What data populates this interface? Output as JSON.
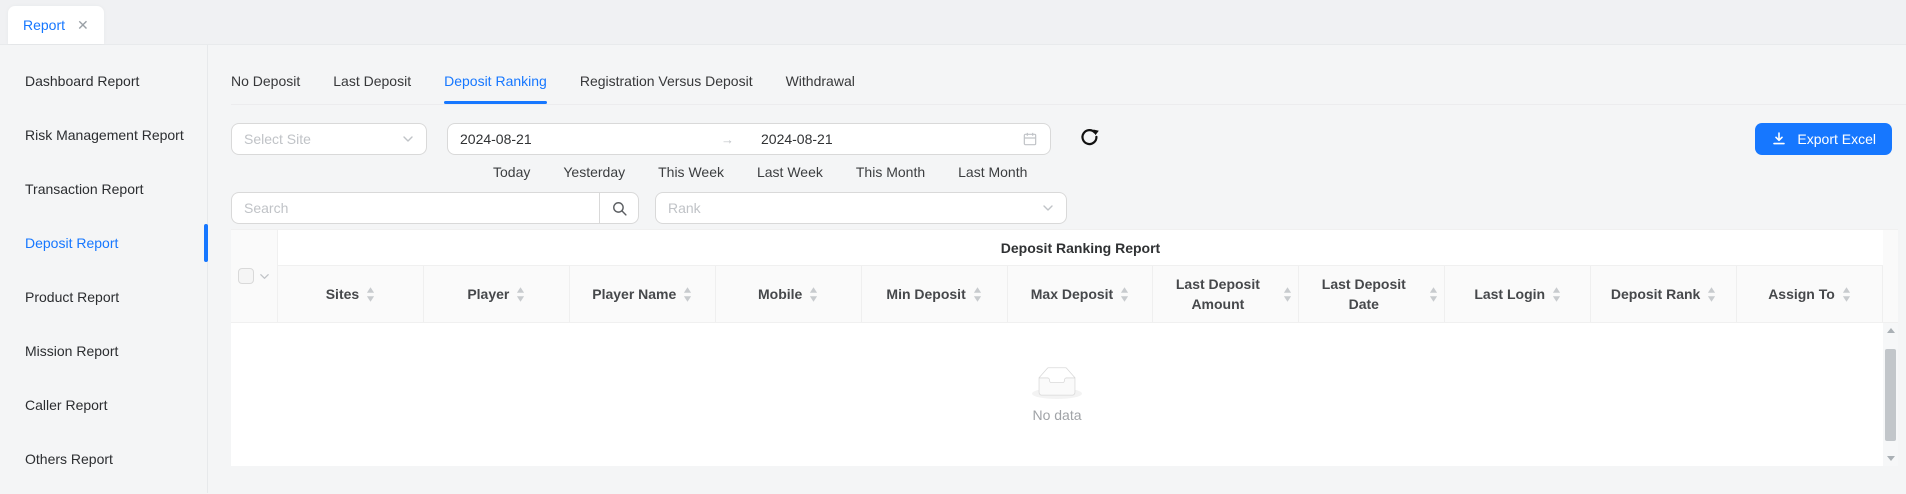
{
  "window": {
    "tab_title": "Report",
    "close_glyph": "✕"
  },
  "sidebar": {
    "items": [
      {
        "label": "Dashboard Report",
        "active": false
      },
      {
        "label": "Risk Management Report",
        "active": false
      },
      {
        "label": "Transaction Report",
        "active": false
      },
      {
        "label": "Deposit Report",
        "active": true
      },
      {
        "label": "Product Report",
        "active": false
      },
      {
        "label": "Mission Report",
        "active": false
      },
      {
        "label": "Caller Report",
        "active": false
      },
      {
        "label": "Others Report",
        "active": false
      }
    ]
  },
  "tabs": {
    "items": [
      "No Deposit",
      "Last Deposit",
      "Deposit Ranking",
      "Registration Versus Deposit",
      "Withdrawal"
    ],
    "active": "Deposit Ranking"
  },
  "filters": {
    "site_placeholder": "Select Site",
    "date_range": {
      "start": "2024-08-21",
      "separator": "→",
      "end": "2024-08-21"
    },
    "quick_links": [
      "Today",
      "Yesterday",
      "This Week",
      "Last Week",
      "This Month",
      "Last Month"
    ],
    "search_placeholder": "Search",
    "rank_placeholder": "Rank",
    "export_label": "Export Excel"
  },
  "table": {
    "title": "Deposit Ranking Report",
    "columns": [
      "Sites",
      "Player",
      "Player Name",
      "Mobile",
      "Min Deposit",
      "Max Deposit",
      "Last Deposit Amount",
      "Last Deposit Date",
      "Last Login",
      "Deposit Rank",
      "Assign To"
    ],
    "rows": [],
    "empty_text": "No data"
  },
  "colors": {
    "accent": "#1677ff",
    "header_bg": "#fafafa",
    "page_bg": "#f4f5f6",
    "border": "#f0f0f0"
  }
}
